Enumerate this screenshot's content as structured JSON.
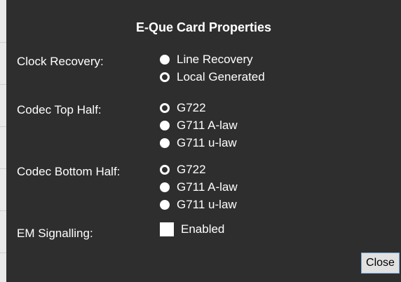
{
  "dialog": {
    "title": "E-Que Card Properties",
    "close_label": "Close"
  },
  "clock_recovery": {
    "label": "Clock Recovery:",
    "options": [
      {
        "label": "Line Recovery",
        "selected": false
      },
      {
        "label": "Local Generated",
        "selected": true
      }
    ]
  },
  "codec_top": {
    "label": "Codec Top Half:",
    "options": [
      {
        "label": "G722",
        "selected": true
      },
      {
        "label": "G711 A-law",
        "selected": false
      },
      {
        "label": "G711 u-law",
        "selected": false
      }
    ]
  },
  "codec_bottom": {
    "label": "Codec Bottom Half:",
    "options": [
      {
        "label": "G722",
        "selected": true
      },
      {
        "label": "G711 A-law",
        "selected": false
      },
      {
        "label": "G711 u-law",
        "selected": false
      }
    ]
  },
  "em_signalling": {
    "label": "EM Signalling:",
    "checkbox_label": "Enabled",
    "checked": false
  }
}
